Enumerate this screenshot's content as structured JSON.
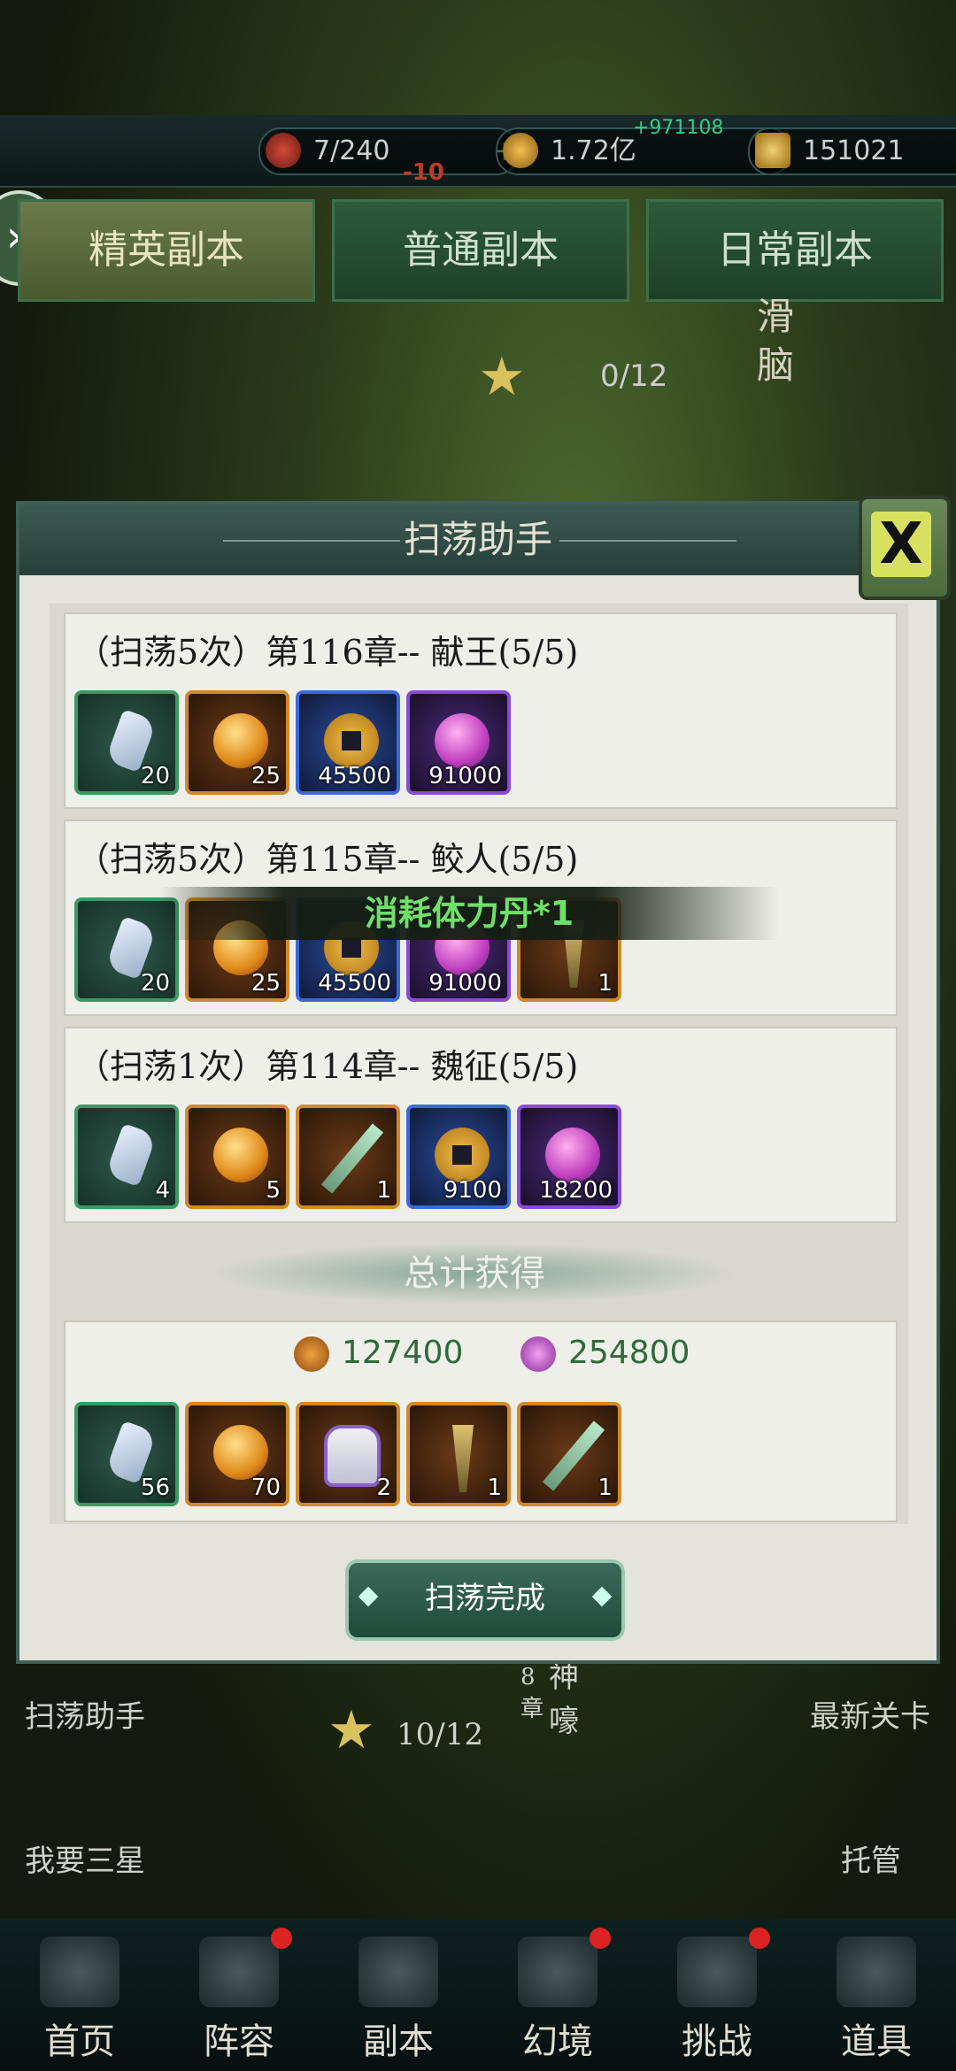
{
  "resources": {
    "stamina": "7/240",
    "coins": "1.72亿",
    "gold": "151021"
  },
  "floating": {
    "damage": "-10",
    "green": "+971108"
  },
  "tabs": [
    "精英副本",
    "普通副本",
    "日常副本"
  ],
  "map": {
    "stars": "0/12",
    "side_chars": "滑脑"
  },
  "dialog": {
    "title": "扫荡助手",
    "close_label": "X",
    "runs": [
      {
        "title": "（扫荡5次）第116章-- 献王(5/5)",
        "items": [
          {
            "type": "crystal",
            "qty": "20",
            "rarity": "green"
          },
          {
            "type": "orb",
            "qty": "25",
            "rarity": "orange"
          },
          {
            "type": "coin",
            "qty": "45500",
            "rarity": "blue"
          },
          {
            "type": "exp",
            "qty": "91000",
            "rarity": "purple"
          }
        ]
      },
      {
        "title": "（扫荡5次）第115章-- 鲛人(5/5)",
        "items": [
          {
            "type": "crystal",
            "qty": "20",
            "rarity": "green"
          },
          {
            "type": "orb",
            "qty": "25",
            "rarity": "orange"
          },
          {
            "type": "coin",
            "qty": "45500",
            "rarity": "blue"
          },
          {
            "type": "exp",
            "qty": "91000",
            "rarity": "purple"
          },
          {
            "type": "boot",
            "qty": "1",
            "rarity": "orange"
          }
        ]
      },
      {
        "title": "（扫荡1次）第114章-- 魏征(5/5)",
        "items": [
          {
            "type": "crystal",
            "qty": "4",
            "rarity": "green"
          },
          {
            "type": "orb",
            "qty": "5",
            "rarity": "orange"
          },
          {
            "type": "sword",
            "qty": "1",
            "rarity": "orange"
          },
          {
            "type": "coin",
            "qty": "9100",
            "rarity": "blue"
          },
          {
            "type": "exp",
            "qty": "18200",
            "rarity": "purple"
          }
        ]
      }
    ],
    "toast": "消耗体力丹*1",
    "total_title": "总计获得",
    "total_coins": "127400",
    "total_exp": "254800",
    "total_items": [
      {
        "type": "crystal",
        "qty": "56",
        "rarity": "green"
      },
      {
        "type": "orb",
        "qty": "70",
        "rarity": "orange"
      },
      {
        "type": "armor",
        "qty": "2",
        "rarity": "orange"
      },
      {
        "type": "boot",
        "qty": "1",
        "rarity": "orange"
      },
      {
        "type": "sword",
        "qty": "1",
        "rarity": "orange"
      }
    ],
    "done_label": "扫荡完成"
  },
  "below": {
    "sweep_helper": "扫荡助手",
    "latest_level": "最新关卡",
    "stars": "10/12",
    "three_star": "我要三星",
    "auto": "托管",
    "chapter": "8章",
    "chapter_name": "神嚎"
  },
  "nav": [
    {
      "label": "首页",
      "dot": false
    },
    {
      "label": "阵容",
      "dot": true
    },
    {
      "label": "副本",
      "dot": false
    },
    {
      "label": "幻境",
      "dot": true
    },
    {
      "label": "挑战",
      "dot": true
    },
    {
      "label": "道具",
      "dot": false
    }
  ]
}
